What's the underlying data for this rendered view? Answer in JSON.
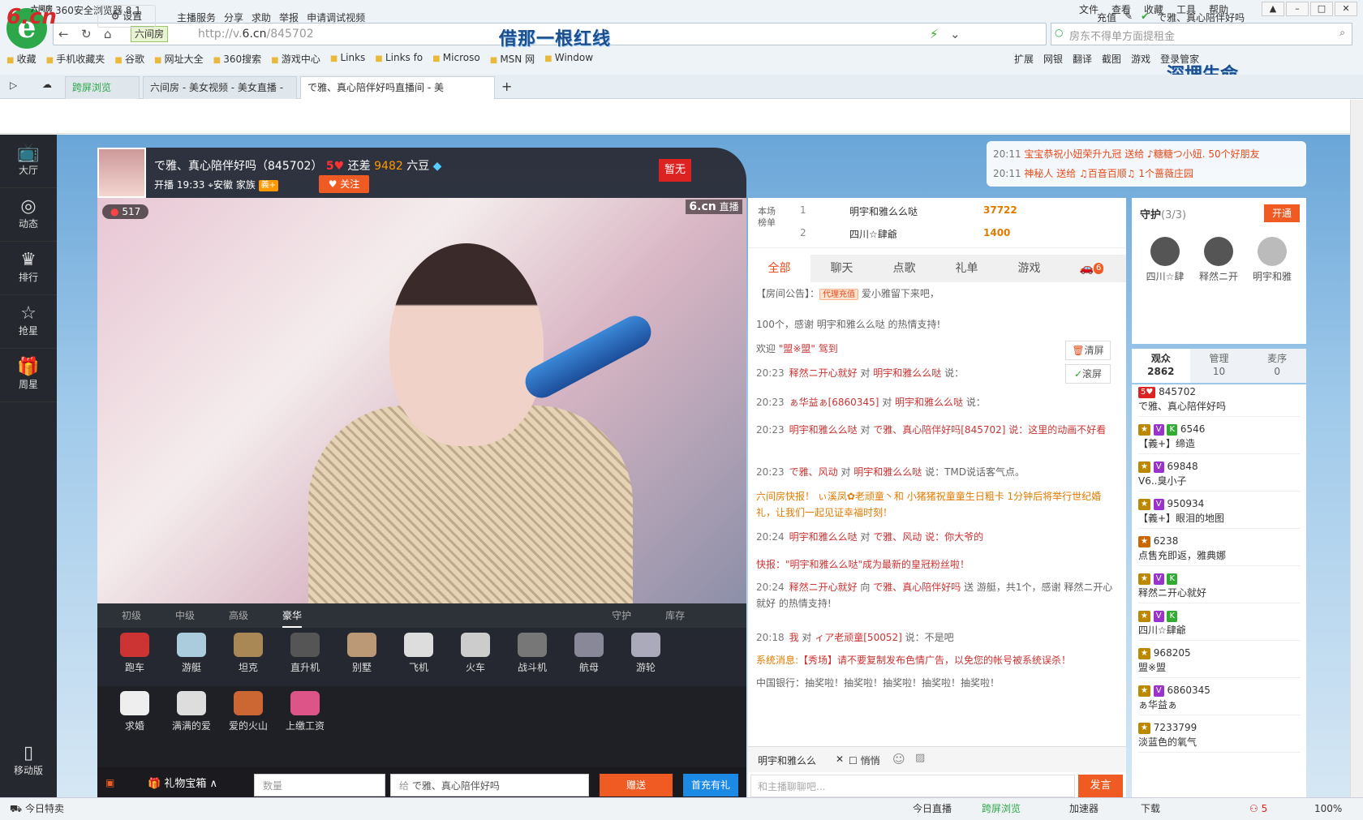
{
  "browser": {
    "app_name": "360安全浏览器 8.1",
    "menu": [
      "文件",
      "查看",
      "收藏",
      "工具",
      "帮助"
    ],
    "site_tag": "六间房",
    "url_prefix": "http://v.",
    "url_domain": "6.cn",
    "url_path": "/845702",
    "search_placeholder": "房东不得单方面提租金",
    "overlay_top": "借那一根红线",
    "overlay_right": "深埋生命",
    "favorites": [
      "收藏",
      "手机收藏夹",
      "谷歌",
      "网址大全",
      "360搜索",
      "游戏中心",
      "Links",
      "Links fo",
      "Microso",
      "MSN 网",
      "Window"
    ],
    "right_tools": [
      "扩展",
      "网银",
      "翻译",
      "截图",
      "游戏",
      "登录管家"
    ],
    "tabs": [
      {
        "label": "跨屏浏览"
      },
      {
        "label": "六间房 - 美女视频 - 美女直播 -"
      },
      {
        "label": "で雅、真心陪伴好吗直播间 - 美"
      }
    ]
  },
  "site": {
    "logo": "6.cn",
    "logo_sub": "六间房",
    "settings": "设置",
    "nav": [
      "主播服务",
      "分享",
      "求助",
      "举报",
      "申请调试视频"
    ],
    "recharge": "充值",
    "user": "で雅、真心陪伴好吗"
  },
  "sidebar": [
    {
      "label": "大厅",
      "icon": "tv-icon"
    },
    {
      "label": "动态",
      "icon": "compass-icon"
    },
    {
      "label": "排行",
      "icon": "crown-icon"
    },
    {
      "label": "抢星",
      "icon": "star-icon"
    },
    {
      "label": "周星",
      "icon": "gift-icon"
    }
  ],
  "sidebar_mobile": "移动版",
  "anchor": {
    "name": "で雅、真心陪伴好吗（845702）",
    "level": "5",
    "remain_label": "还差",
    "remain_value": "9482",
    "remain_unit": "六豆",
    "start": "开播 19:33",
    "location": "安徽",
    "family": "家族",
    "family_badge": "義+",
    "follow": "关注",
    "flag": "暂无",
    "viewers": "517",
    "watermark": "6.cn",
    "watermark_tag": "直播"
  },
  "gift_tabs": [
    "初级",
    "中级",
    "高级",
    "豪华",
    "守护",
    "库存"
  ],
  "gifts_row1": [
    "跑车",
    "游艇",
    "坦克",
    "直升机",
    "别墅",
    "飞机",
    "火车",
    "战斗机",
    "航母",
    "游轮"
  ],
  "gifts_row2": [
    "求婚",
    "满满的爱",
    "爱的火山",
    "上缴工资"
  ],
  "giftbar": {
    "box": "礼物宝箱",
    "qty_placeholder": "数量",
    "to_prefix": "给",
    "to_name": "で雅、真心陪伴好吗",
    "send": "赠送",
    "recharge": "首充有礼"
  },
  "rank": {
    "label": "本场榜单",
    "rows": [
      {
        "no": "1",
        "name": "明宇和雅么么哒",
        "value": "37722"
      },
      {
        "no": "2",
        "name": "四川☆肆爺",
        "value": "1400"
      }
    ]
  },
  "chat_tabs": [
    "全部",
    "聊天",
    "点歌",
    "礼单",
    "游戏"
  ],
  "chat_badge": "6",
  "chat": [
    {
      "pre": "【房间公告】：",
      "tag": "代理充值",
      "text": "爱小雅留下来吧，"
    },
    {
      "pre": "",
      "tag": "",
      "text": "100个，感谢 明宇和雅么么哒 的热情支持!"
    },
    {
      "pre": "欢迎",
      "tag": "",
      "text": "\"盟※盟\" 驾到"
    },
    {
      "time": "20:23",
      "from": "释然ニ开心就好",
      "to": "明宇和雅么么哒",
      "text": "说："
    },
    {
      "time": "20:23",
      "from": "ぁ华益ぁ[6860345]",
      "to": "明宇和雅么么哒",
      "text": "说："
    },
    {
      "time": "20:23",
      "from": "明宇和雅么么哒",
      "to": "で雅、真心陪伴好吗[845702]",
      "text": "说：这里的动画不好看"
    },
    {
      "time": "20:23",
      "from": "で雅、风动",
      "to": "明宇和雅么么哒",
      "text": "说：TMD说话客气点。"
    },
    {
      "pre": "六间房快报！",
      "text": "ぃ溪凤✿老顽童丶和 小猪猪祝童童生日粗卡 1分钟后将举行世纪婚礼，让我们一起见证幸福时刻！"
    },
    {
      "time": "20:24",
      "from": "明宇和雅么么哒",
      "to": "で雅、风动",
      "text": "说：你大爷的"
    },
    {
      "pre": "快报：",
      "text": "\"明宇和雅么么哒\"成为最新的皇冠粉丝啦！"
    },
    {
      "time": "20:24",
      "from": "释然ニ开心就好",
      "to": "で雅、真心陪伴好吗",
      "text": "送 游艇，共1个，感谢 释然ニ开心就好 的热情支持!"
    },
    {
      "time": "20:18",
      "from": "我",
      "to": "ィア老顽童[50052]",
      "text": "说：不是吧"
    },
    {
      "pre": "系统消息:",
      "text": "【秀场】请不要复制发布色情广告，以免您的帐号被系统误杀！"
    },
    {
      "pre": "",
      "text": "中国银行：抽奖啦！抽奖啦！抽奖啦！抽奖啦！抽奖啦！"
    }
  ],
  "chat_ctl": [
    "清屏",
    "滚屏"
  ],
  "chat_input": {
    "target": "明宇和雅么么",
    "whisper": "悄悄",
    "placeholder": "和主播聊聊吧...",
    "send": "发言"
  },
  "notice": [
    {
      "time": "20:11",
      "text": "宝宝恭祝小妞荣升九冠 送给 ♪糖糖つ小妞. 50个好朋友"
    },
    {
      "time": "20:11",
      "text": "神秘人 送给 ♫百音百顺♫ 1个蔷薇庄园"
    }
  ],
  "guard": {
    "title": "守护",
    "count": "(3/3)",
    "open": "开通",
    "members": [
      "四川☆肆",
      "释然ニ开",
      "明宇和雅"
    ]
  },
  "aud_tabs": [
    {
      "label": "观众",
      "count": "2862"
    },
    {
      "label": "管理",
      "count": "10"
    },
    {
      "label": "麦序",
      "count": "0"
    }
  ],
  "audience": [
    {
      "id": "845702",
      "name": "で雅、真心陪伴好吗"
    },
    {
      "id": "6546",
      "name": "【義+】缔造"
    },
    {
      "id": "69848",
      "name": "V6..臭小子"
    },
    {
      "id": "950934",
      "name": "【義+】眼泪的地图"
    },
    {
      "id": "6238",
      "name": "点售充即返，雅典娜"
    },
    {
      "id": "",
      "name": "释然ニ开心就好"
    },
    {
      "id": "",
      "name": "四川☆肆爺"
    },
    {
      "id": "968205",
      "name": "盟※盟"
    },
    {
      "id": "6860345",
      "name": "ぁ华益ぁ"
    },
    {
      "id": "7233799",
      "name": "淡蓝色的氧气"
    }
  ],
  "status": {
    "left": "今日特卖",
    "items": [
      "今日直播",
      "跨屏浏览",
      "加速器",
      "下载",
      "100%"
    ],
    "user_count": "5"
  },
  "colors": {
    "accent": "#f05a23",
    "brand_red": "#d52a2a",
    "sidebar": "#25292f"
  }
}
